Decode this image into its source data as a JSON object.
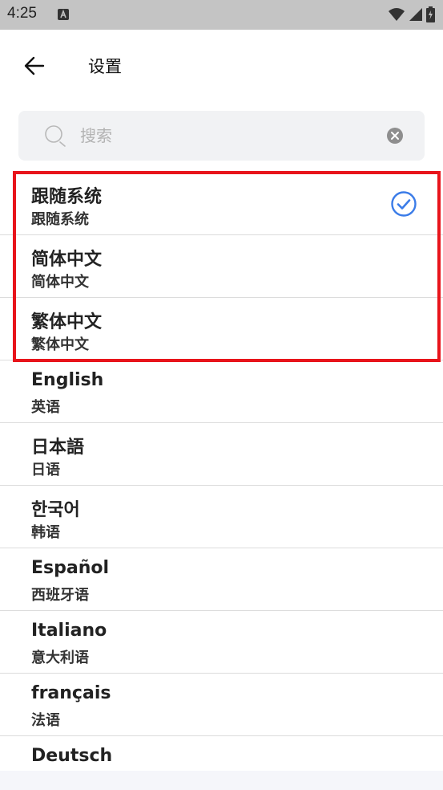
{
  "status_bar": {
    "time": "4:25",
    "icons": [
      "a-notification-icon",
      "wifi-icon",
      "signal-icon",
      "battery-icon"
    ]
  },
  "header": {
    "title": "设置",
    "back_icon": "arrow-left-icon"
  },
  "search": {
    "placeholder": "搜索",
    "value": "",
    "icon": "search-icon",
    "clear_icon": "clear-icon"
  },
  "languages": [
    {
      "primary": "跟随系统",
      "secondary": "跟随系统",
      "selected": true
    },
    {
      "primary": "简体中文",
      "secondary": "简体中文",
      "selected": false
    },
    {
      "primary": "繁体中文",
      "secondary": "繁体中文",
      "selected": false
    },
    {
      "primary": "English",
      "secondary": "英语",
      "selected": false
    },
    {
      "primary": "日本語",
      "secondary": "日语",
      "selected": false
    },
    {
      "primary": "한국어",
      "secondary": "韩语",
      "selected": false
    },
    {
      "primary": "Español",
      "secondary": "西班牙语",
      "selected": false
    },
    {
      "primary": "Italiano",
      "secondary": "意大利语",
      "selected": false
    },
    {
      "primary": "français",
      "secondary": "法语",
      "selected": false
    },
    {
      "primary": "Deutsch",
      "secondary": "",
      "selected": false
    }
  ],
  "colors": {
    "status_bar": "#c4c4c4",
    "highlight": "#e8141b",
    "check": "#3b7ce8",
    "divider": "#dcdcdc",
    "search_bg": "#f1f2f4"
  }
}
